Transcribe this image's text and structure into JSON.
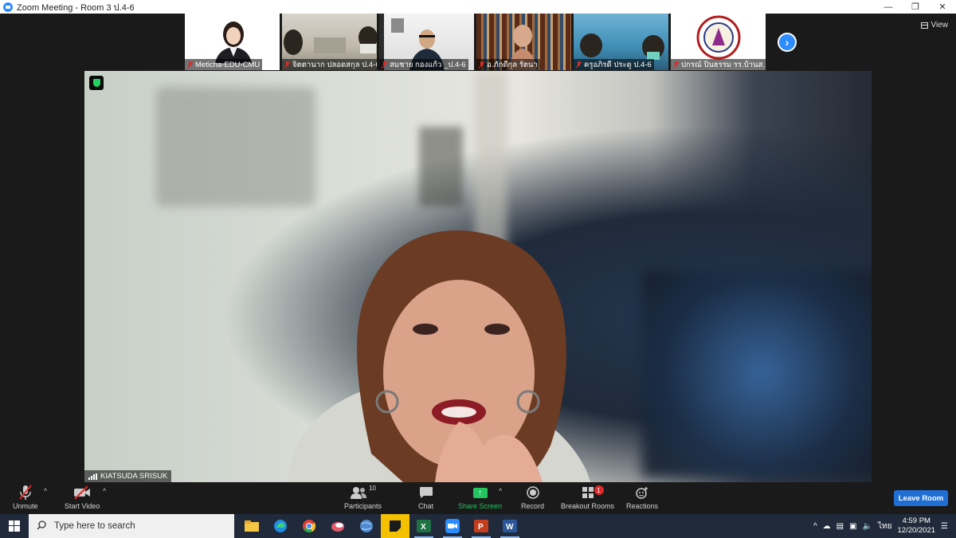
{
  "window": {
    "title": "Zoom Meeting - Room 3 ป.4-6"
  },
  "view_label": "View",
  "thumbnails": [
    {
      "name": "Meticha-EDU-CMU"
    },
    {
      "name": "จิตตานาก ปลอดสกุล ป.4-6"
    },
    {
      "name": "สมชาย กองแก้ว _ป.4-6"
    },
    {
      "name": "อ.ภักดีกุล รัตนา"
    },
    {
      "name": "ครูอภิรดี ประดู ป.4-6"
    },
    {
      "name": "ปกรณ์ ปิ่นธรรม รร.บ้านส..."
    }
  ],
  "speaker": {
    "name": "KIATSUDA SRISUK"
  },
  "toolbar": {
    "unmute": "Unmute",
    "start_video": "Start Video",
    "participants": "Participants",
    "participants_count": "10",
    "chat": "Chat",
    "share_screen": "Share Screen",
    "record": "Record",
    "breakout_rooms": "Breakout Rooms",
    "breakout_badge": "1",
    "reactions": "Reactions",
    "leave": "Leave Room"
  },
  "taskbar": {
    "search_placeholder": "Type here to search",
    "language": "ไทย",
    "time": "4:59 PM",
    "date": "12/20/2021"
  },
  "colors": {
    "accent": "#2d8cff",
    "share_green": "#24c45e",
    "leave_blue": "#1f6ed4",
    "muted_red": "#e02828"
  }
}
